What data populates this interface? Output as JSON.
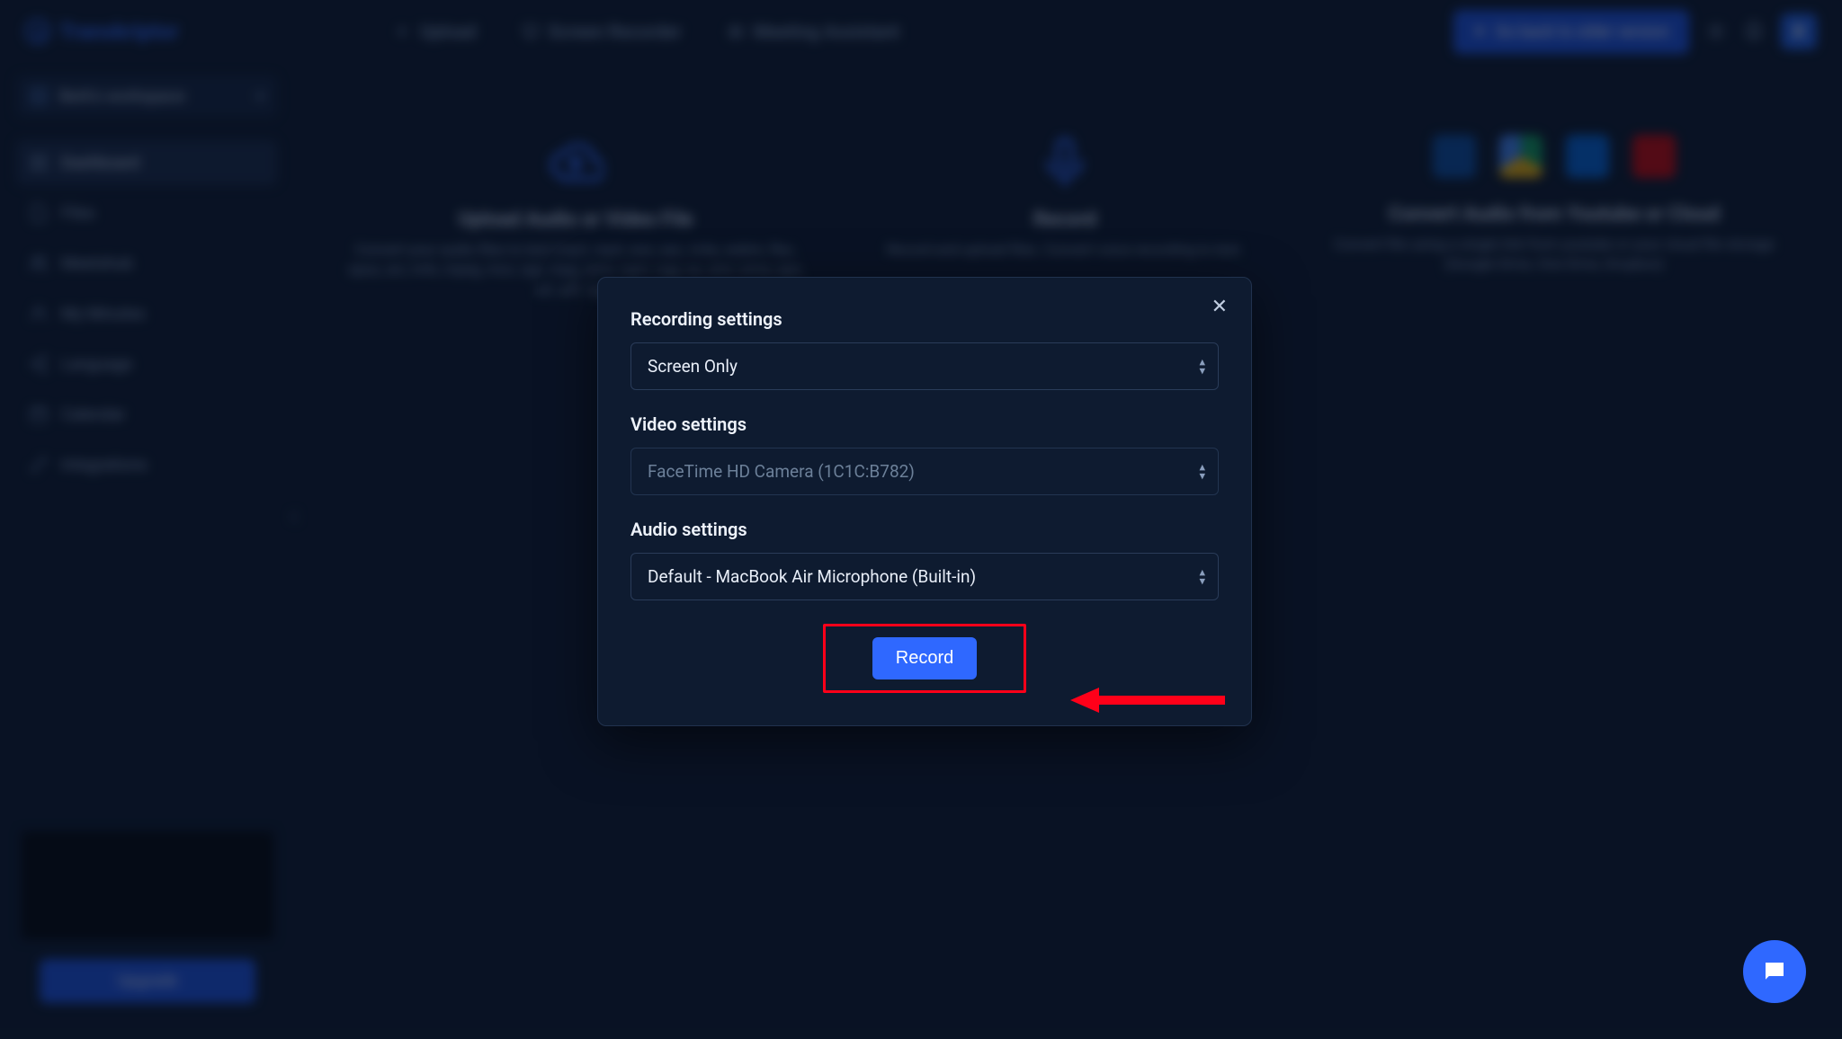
{
  "brand": {
    "name": "Transkriptor"
  },
  "topnav": {
    "upload": "Upload",
    "screen_recorder": "Screen Recorder",
    "meeting_assistant": "Meeting Assistant"
  },
  "cta": {
    "label": "Go back to older version"
  },
  "avatar": {
    "initial": "B"
  },
  "workspace": {
    "label": "Berk's workspace"
  },
  "sidebar": {
    "items": [
      {
        "label": "Dashboard",
        "icon": "grid-icon",
        "active": true
      },
      {
        "label": "Files",
        "icon": "note-icon"
      },
      {
        "label": "Meetshub",
        "icon": "users-icon"
      },
      {
        "label": "My Minutes",
        "icon": "user-icon"
      },
      {
        "label": "Language",
        "icon": "share-icon"
      },
      {
        "label": "Calendar",
        "icon": "calendar-icon"
      },
      {
        "label": "Integrations",
        "icon": "puzzle-icon"
      }
    ]
  },
  "bottom": {
    "upgrade": "Upgrade"
  },
  "cards": {
    "upload": {
      "title": "Upload Audio or Video File",
      "desc": "Convert your audio files to text (mp3, mp4, wav, aac, m4a, webm, flac, opus, avi, m4v, mpeg, mov, ogv, mpg, wmv, ogm, ogg, au, amr, wma, ape, aif, aiff, 3ga)"
    },
    "record": {
      "title": "Record",
      "desc": "Record and upload files. Convert voice recording to text."
    },
    "cloud": {
      "title": "Convert Audio from Youtube or Cloud",
      "desc": "Convert file using a single link from youtube or your cloud file storage (Google Drive, One Drive, Dropbox)"
    }
  },
  "modal": {
    "recording_label": "Recording settings",
    "recording_value": "Screen Only",
    "video_label": "Video settings",
    "video_value": "FaceTime HD Camera (1C1C:B782)",
    "audio_label": "Audio settings",
    "audio_value": "Default - MacBook Air Microphone (Built-in)",
    "record_btn": "Record"
  },
  "annotation": {
    "arrow_color": "#ff0019",
    "highlight_target": "record-button"
  }
}
